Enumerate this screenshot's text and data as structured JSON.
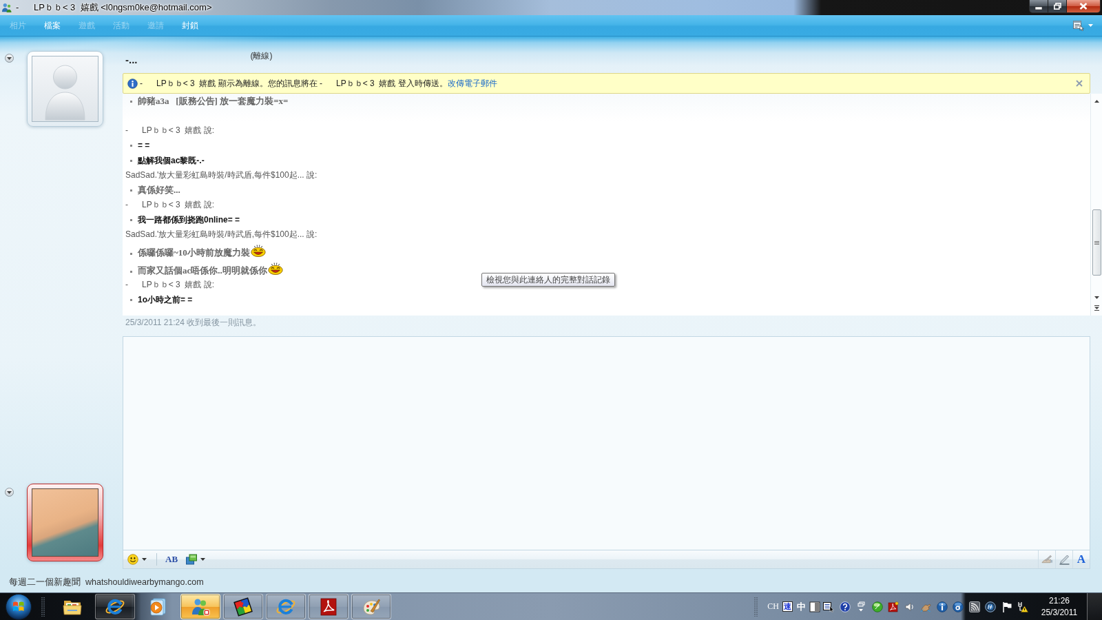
{
  "window": {
    "title": "-      LPｂｂ< 3  嬉戲 <l0ngsm0ke@hotmail.com>"
  },
  "menu": [
    {
      "label": "相片",
      "disabled": true
    },
    {
      "label": "檔案",
      "disabled": false
    },
    {
      "label": "遊戲",
      "disabled": true
    },
    {
      "label": "活動",
      "disabled": true
    },
    {
      "label": "邀請",
      "disabled": true
    },
    {
      "label": "封鎖",
      "disabled": false
    }
  ],
  "contact": {
    "name": "-...",
    "status": "(離線)"
  },
  "info_bar": {
    "text": "-      LPｂｂ< 3  嬉戲 顯示為離線。您的訊息將在 -      LPｂｂ< 3  嬉戲 登入時傳送。",
    "link": "改傳電子郵件"
  },
  "conversation": [
    {
      "kind": "self",
      "messages": [
        {
          "text": "帥豬a3a   [販務公告] 放一套魔力裝=x=",
          "emoticon": false
        }
      ]
    },
    {
      "kind": "contact",
      "sender": "-      LPｂｂ< 3  嬉戲 說:",
      "messages": [
        {
          "text": "= =",
          "emoticon": false
        },
        {
          "text": "點解我個ac黎既-.-",
          "emoticon": false
        }
      ]
    },
    {
      "kind": "self",
      "sender": "SadSad.'放大量彩虹島時裝/時武盾,每件$100起... 說:",
      "messages": [
        {
          "text": "真係好笑...",
          "emoticon": false
        }
      ]
    },
    {
      "kind": "contact",
      "sender": "-      LPｂｂ< 3  嬉戲 說:",
      "messages": [
        {
          "text": "我一路都係到挠跑0nline= =",
          "emoticon": false
        }
      ]
    },
    {
      "kind": "self",
      "sender": "SadSad.'放大量彩虹島時裝/時武盾,每件$100起... 說:",
      "messages": [
        {
          "text": "係囉係囉~10小時前放魔力裝",
          "emoticon": true
        },
        {
          "text": "而家又話個ac唔係你..明明就係你",
          "emoticon": true
        }
      ]
    },
    {
      "kind": "contact",
      "sender": "-      LPｂｂ< 3  嬉戲 說:",
      "messages": [
        {
          "text": "1o小時之前= =",
          "emoticon": false
        }
      ]
    }
  ],
  "last_received": "25/3/2011 21:24 收到最後一則訊息。",
  "tooltip": "檢視您與此連絡人的完整對話記錄",
  "input_toolbar": {
    "left": [
      {
        "kind": "emoticon",
        "dropdown": true
      },
      {
        "kind": "font",
        "glyph": "AB",
        "dropdown": false
      },
      {
        "kind": "background",
        "dropdown": true
      }
    ],
    "right": [
      {
        "kind": "handwriting"
      },
      {
        "kind": "ink"
      },
      {
        "kind": "text-mode",
        "glyph": "A"
      }
    ]
  },
  "status_text": "每週二一個新趣聞  whatshouldiwearbymango.com",
  "taskbar": {
    "apps": [
      {
        "kind": "folder",
        "running": false,
        "selected": false
      },
      {
        "kind": "browser",
        "running": true,
        "selected": false
      },
      {
        "kind": "media",
        "running": false,
        "selected": false
      },
      {
        "kind": "messenger",
        "running": true,
        "selected": true
      },
      {
        "kind": "puzzle",
        "running": true,
        "selected": false
      },
      {
        "kind": "browser",
        "running": true,
        "selected": false
      },
      {
        "kind": "pdf",
        "running": true,
        "selected": false
      },
      {
        "kind": "paint",
        "running": true,
        "selected": false
      }
    ],
    "tray": {
      "language": "CH",
      "ime_mode": "速",
      "ime_char": "中"
    },
    "clock": {
      "time": "21:26",
      "date": "25/3/2011"
    }
  }
}
